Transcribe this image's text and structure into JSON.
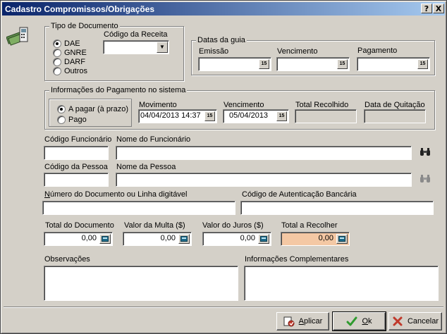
{
  "window": {
    "title": "Cadastro Compromissos/Obrigações",
    "help_label": "?",
    "close_label": "X"
  },
  "tipo_documento": {
    "group_title": "Tipo de Documento",
    "options": [
      {
        "label": "DAE",
        "selected": true
      },
      {
        "label": "GNRE",
        "selected": false
      },
      {
        "label": "DARF",
        "selected": false
      },
      {
        "label": "Outros",
        "selected": false
      }
    ],
    "codigo_receita_label": "Código da Receita",
    "codigo_receita_value": ""
  },
  "datas_guia": {
    "group_title": "Datas da guia",
    "emissao_label": "Emissão",
    "vencimento_label": "Vencimento",
    "pagamento_label": "Pagamento",
    "emissao_value": "",
    "vencimento_value": "",
    "pagamento_value": ""
  },
  "pagamento_sistema": {
    "group_title": "Informações do Pagamento no sistema",
    "options": [
      {
        "label": "A pagar (à prazo)",
        "selected": true
      },
      {
        "label": "Pago",
        "selected": false
      }
    ],
    "movimento_label": "Movimento",
    "movimento_value": "04/04/2013 14:37",
    "vencimento_label": "Vencimento",
    "vencimento_value": "05/04/2013",
    "total_recolhido_label": "Total Recolhido",
    "total_recolhido_value": "",
    "data_quitacao_label": "Data de Quitação",
    "data_quitacao_value": ""
  },
  "funcionario": {
    "codigo_label": "Código Funcionário",
    "nome_label": "Nome do Funcionário",
    "codigo_value": "",
    "nome_value": ""
  },
  "pessoa": {
    "codigo_label": "Código da Pessoa",
    "nome_label": "Nome da Pessoa",
    "codigo_value": "",
    "nome_value": ""
  },
  "documento": {
    "numero_label_first": "N",
    "numero_label_rest": "úmero do Documento ou Linha digitável",
    "numero_value": "",
    "autenticacao_label": "Código de Autenticação Bancária",
    "autenticacao_value": ""
  },
  "valores": {
    "total_documento_label": "Total do Documento",
    "total_documento_value": "0,00",
    "multa_label": "Valor da Multa ($)",
    "multa_value": "0,00",
    "juros_label": "Valor do Juros ($)",
    "juros_value": "0,00",
    "total_recolher_label": "Total a Recolher",
    "total_recolher_value": "0,00"
  },
  "observacoes_label": "Observações",
  "observacoes_value": "",
  "info_complementares_label": "Informações Complementares",
  "info_complementares_value": "",
  "calendar_glyph": "15",
  "combo_arrow": "▼",
  "buttons": {
    "aplicar_first": "A",
    "aplicar_rest": "plicar",
    "ok_first": "O",
    "ok_rest": "k",
    "cancelar_label": "Cancelar"
  },
  "colors": {
    "title_start": "#0a246a",
    "title_end": "#a6caf0",
    "window_bg": "#d4d0c8",
    "total_recolher_bg": "#f4c8a4"
  }
}
